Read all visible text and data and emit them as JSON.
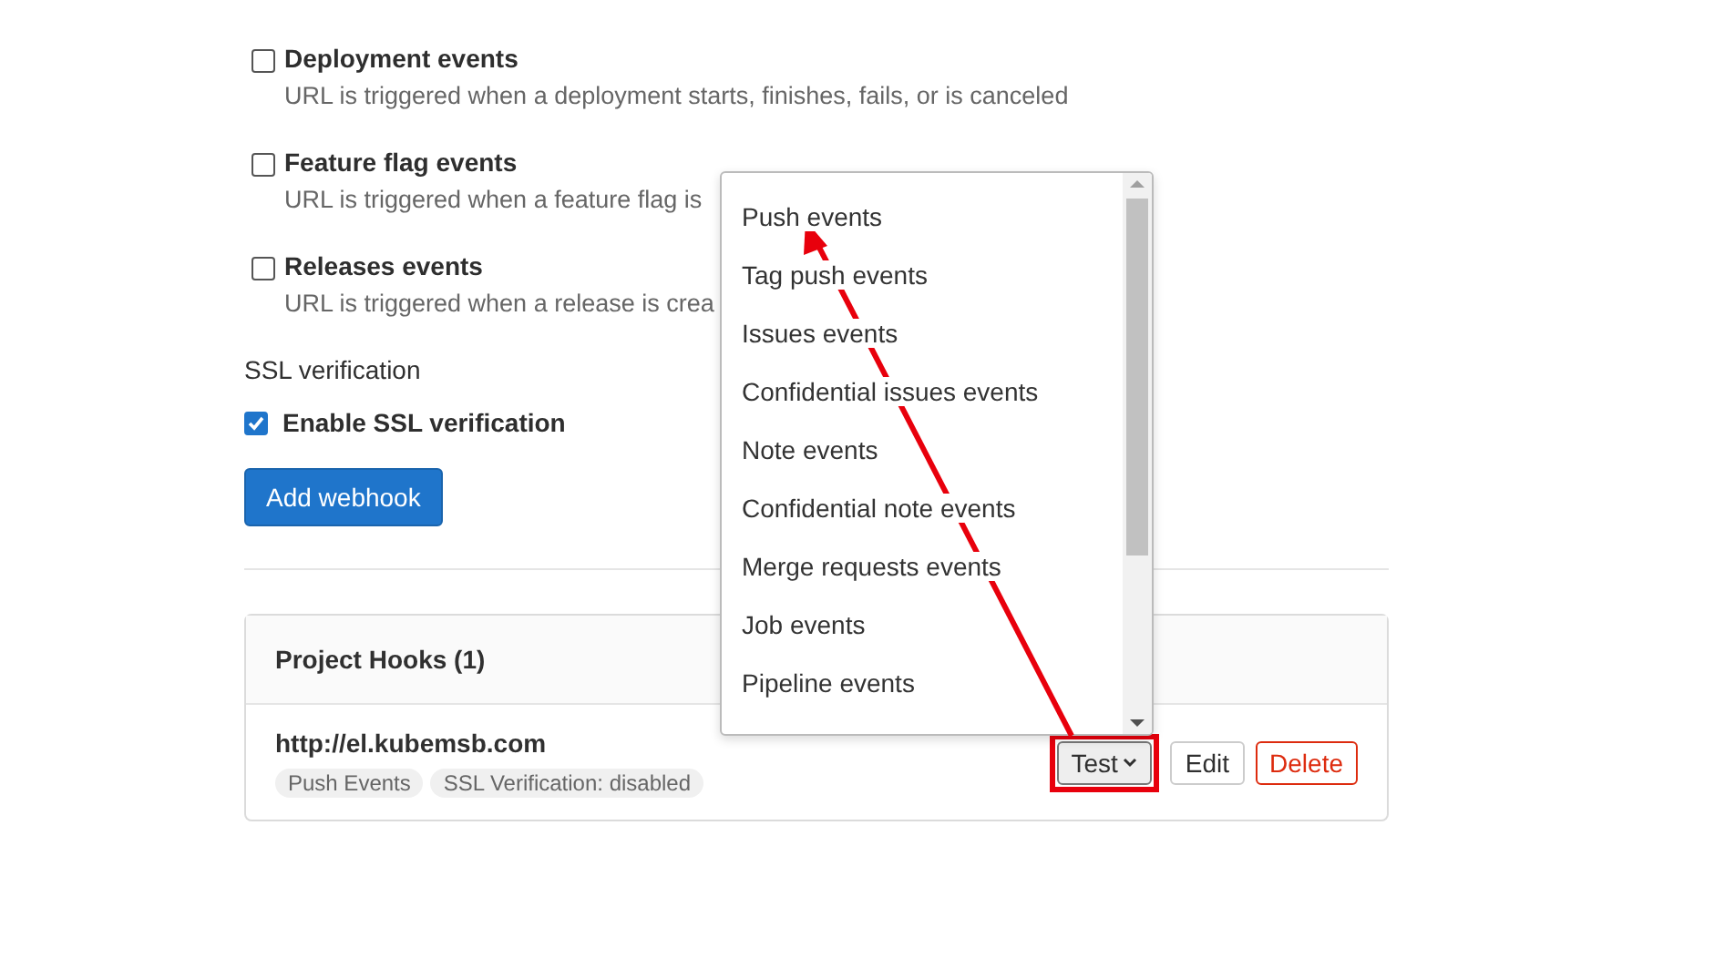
{
  "events": [
    {
      "label": "Deployment events",
      "description": "URL is triggered when a deployment starts, finishes, fails, or is canceled",
      "checked": false
    },
    {
      "label": "Feature flag events",
      "description": "URL is triggered when a feature flag is",
      "checked": false
    },
    {
      "label": "Releases events",
      "description": "URL is triggered when a release is crea",
      "checked": false
    }
  ],
  "ssl": {
    "heading": "SSL verification",
    "label": "Enable SSL verification",
    "checked": true
  },
  "add_button": "Add webhook",
  "hooks": {
    "title": "Project Hooks (1)",
    "items": [
      {
        "url": "http://el.kubemsb.com",
        "badges": [
          "Push Events",
          "SSL Verification: disabled"
        ],
        "test_button": "Test",
        "expanded": true,
        "edit_button": "Edit",
        "delete_button": "Delete"
      }
    ]
  },
  "test_menu": {
    "items": [
      "Push events",
      "Tag push events",
      "Issues events",
      "Confidential issues events",
      "Note events",
      "Confidential note events",
      "Merge requests events",
      "Job events",
      "Pipeline events"
    ]
  }
}
